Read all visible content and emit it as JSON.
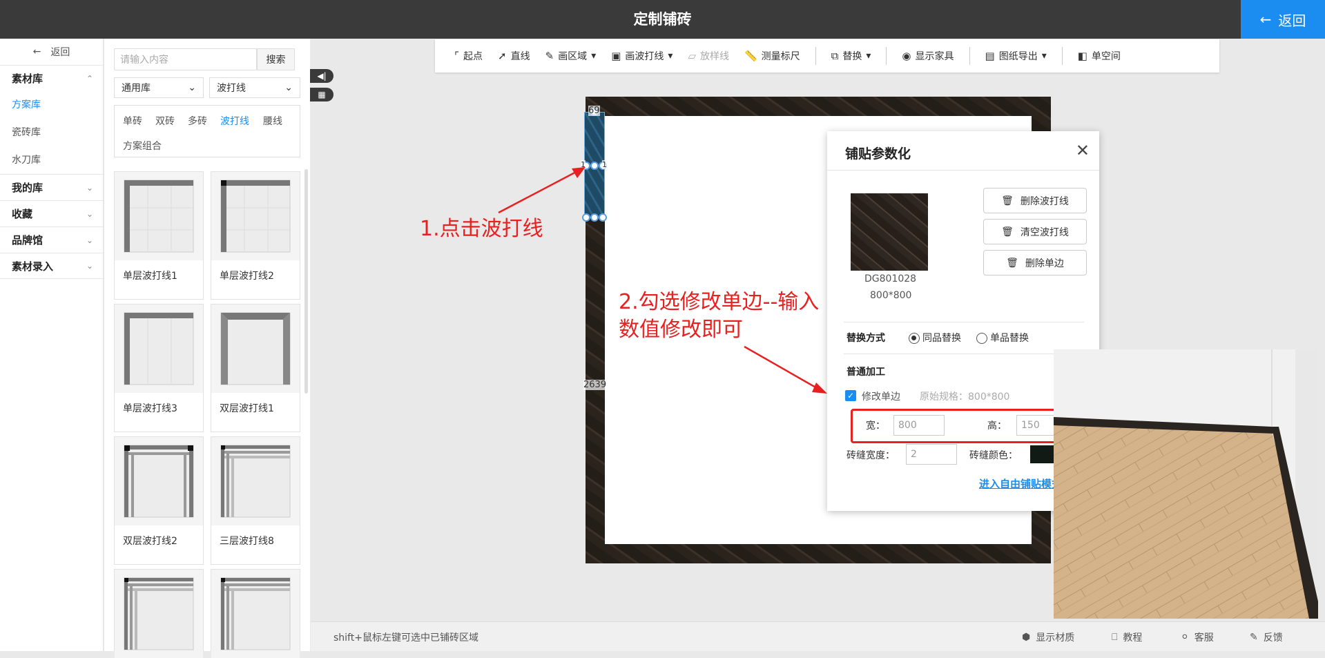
{
  "header": {
    "title": "定制铺砖",
    "back_label": "返回"
  },
  "leftnav": {
    "back_label": "返回",
    "sections": [
      {
        "label": "素材库",
        "expanded": true,
        "items": [
          "方案库",
          "瓷砖库",
          "水刀库"
        ],
        "active_item": "方案库"
      },
      {
        "label": "我的库"
      },
      {
        "label": "收藏"
      },
      {
        "label": "品牌馆"
      },
      {
        "label": "素材录入"
      }
    ]
  },
  "library": {
    "search_placeholder": "请输入内容",
    "search_button": "搜索",
    "dropdown_library": "通用库",
    "dropdown_category": "波打线",
    "filters": [
      "单砖",
      "双砖",
      "多砖",
      "波打线",
      "腰线",
      "方案组合"
    ],
    "active_filter": "波打线",
    "items": [
      "单层波打线1",
      "单层波打线2",
      "单层波打线3",
      "双层波打线1",
      "双层波打线2",
      "三层波打线8"
    ]
  },
  "toolbar": {
    "items": [
      "起点",
      "直线",
      "画区域",
      "画波打线",
      "放样线",
      "测量标尺",
      "替换",
      "显示家具",
      "图纸导出",
      "单空间"
    ],
    "disabled": [
      "放样线"
    ]
  },
  "canvas": {
    "dim_top": "69",
    "dim_side": "2639",
    "handle_mid_left": "1",
    "handle_mid_right": "1"
  },
  "annotations": {
    "step1": "1.点击波打线",
    "step2_line1": "2.勾选修改单边--输入",
    "step2_line2": "数值修改即可",
    "color": "#e82020"
  },
  "dialog": {
    "title": "铺贴参数化",
    "tile_code": "DG801028",
    "tile_size": "800*800",
    "buttons": [
      "删除波打线",
      "清空波打线",
      "删除单边"
    ],
    "replace_label": "替换方式",
    "replace_options": [
      "同品替换",
      "单品替换"
    ],
    "replace_selected": "同品替换",
    "processing_label": "普通加工",
    "modify_edge_label": "修改单边",
    "modify_edge_checked": true,
    "original_spec": "原始规格：800*800",
    "width_label": "宽：",
    "width_value": "800",
    "height_label": "高：",
    "height_value": "150",
    "gap_label": "砖缝宽度：",
    "gap_value": "2",
    "gap_color_label": "砖缝颜色：",
    "gap_color": "#111a14",
    "free_mode_link": "进入自由铺贴模式"
  },
  "statusbar": {
    "hint": "shift+鼠标左键可选中已铺砖区域",
    "items": [
      "显示材质",
      "教程",
      "客服",
      "反馈"
    ]
  },
  "colors": {
    "accent": "#1b8cf0",
    "topbar": "#3a3a3a",
    "annotation": "#e82020"
  }
}
